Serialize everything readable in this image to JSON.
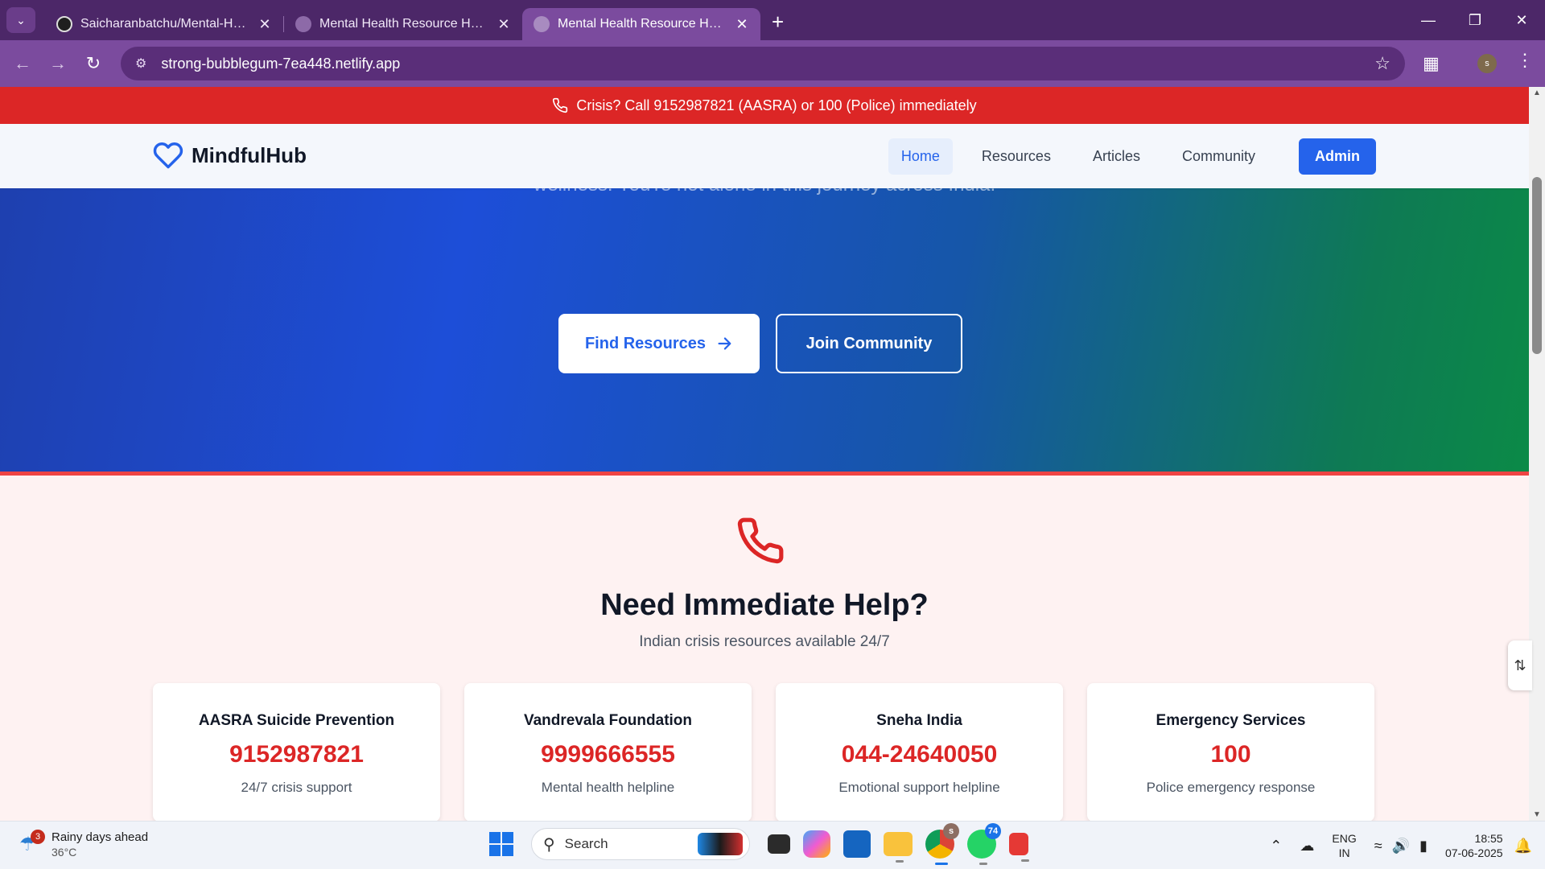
{
  "browser": {
    "tabs": [
      {
        "title": "Saicharanbatchu/Mental-Health",
        "favicon": "github-icon",
        "active": false
      },
      {
        "title": "Mental Health Resource Hub - S",
        "favicon": "globe-icon",
        "active": false
      },
      {
        "title": "Mental Health Resource Hub - S",
        "favicon": "globe-icon",
        "active": true
      }
    ],
    "url": "strong-bubblegum-7ea448.netlify.app",
    "profile_initial": "s"
  },
  "page": {
    "crisis_banner": "Crisis? Call 9152987821 (AASRA) or 100 (Police) immediately",
    "brand": "MindfulHub",
    "nav": {
      "home": "Home",
      "resources": "Resources",
      "articles": "Articles",
      "community": "Community",
      "admin": "Admin"
    },
    "hero": {
      "subtitle_partial": "wellness. You're not alone in this journey across India.",
      "find_resources": "Find Resources",
      "join_community": "Join Community"
    },
    "help": {
      "title": "Need Immediate Help?",
      "subtitle": "Indian crisis resources available 24/7",
      "cards": [
        {
          "name": "AASRA Suicide Prevention",
          "number": "9152987821",
          "desc": "24/7 crisis support"
        },
        {
          "name": "Vandrevala Foundation",
          "number": "9999666555",
          "desc": "Mental health helpline"
        },
        {
          "name": "Sneha India",
          "number": "044-24640050",
          "desc": "Emotional support helpline"
        },
        {
          "name": "Emergency Services",
          "number": "100",
          "desc": "Police emergency response"
        }
      ]
    },
    "colors": {
      "crisis_red": "#dc2626",
      "primary_blue": "#2563eb",
      "hero_gradient_start": "#1e40af",
      "hero_gradient_end": "#0b8a47"
    }
  },
  "taskbar": {
    "weather_title": "Rainy days ahead",
    "weather_temp": "36°C",
    "weather_badge": "3",
    "search_placeholder": "Search",
    "chrome_badge": "s",
    "whatsapp_badge": "74",
    "lang_line1": "ENG",
    "lang_line2": "IN",
    "time": "18:55",
    "date": "07-06-2025"
  }
}
